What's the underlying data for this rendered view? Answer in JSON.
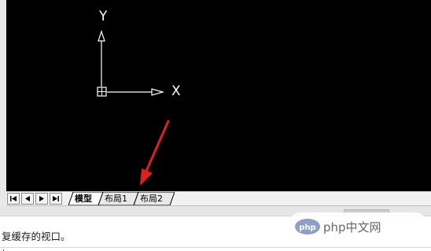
{
  "viewport": {
    "ucs_icon": {
      "y_label": "Y",
      "x_label": "X"
    },
    "annotation": {
      "color": "#e02020"
    }
  },
  "tabbar": {
    "nav_buttons": [
      "first",
      "previous",
      "next",
      "last"
    ],
    "tabs": [
      {
        "label": "模型",
        "active": true
      },
      {
        "label": "布局1",
        "active": false
      },
      {
        "label": "布局2",
        "active": false
      }
    ]
  },
  "command_window": {
    "text": "复缓存的视口。"
  },
  "watermark": {
    "text": "php中文网",
    "logo_text": "php"
  },
  "colors": {
    "drawing_background": "#000000",
    "drawing_foreground": "#ffffff",
    "annotation_arrow": "#e02020",
    "tabbar_background": "#f1f1f1"
  }
}
